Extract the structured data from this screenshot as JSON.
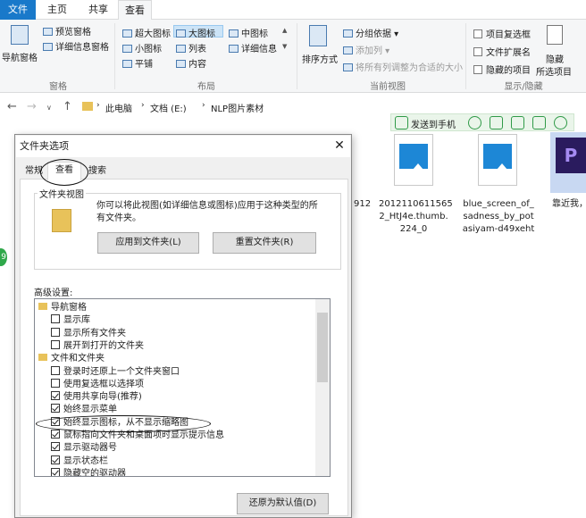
{
  "tabs": {
    "file": "文件",
    "home": "主页",
    "share": "共享",
    "view": "查看"
  },
  "ribbon": {
    "pane": {
      "nav_pane": "导航窗格",
      "preview": "预览窗格",
      "details": "详细信息窗格",
      "group": "窗格"
    },
    "layout": {
      "xl": "超大图标",
      "large": "大图标",
      "medium": "中图标",
      "small": "小图标",
      "list": "列表",
      "details": "详细信息",
      "tiles": "平铺",
      "content": "内容",
      "group": "布局"
    },
    "view": {
      "sort": "排序方式",
      "group_by": "分组依据",
      "add_column": "添加列",
      "fit_columns": "将所有列调整为合适的大小",
      "group": "当前视图"
    },
    "showhide": {
      "checkboxes": "项目复选框",
      "extensions": "文件扩展名",
      "hidden": "隐藏的项目",
      "hide": "隐藏",
      "selected": "所选项目",
      "group": "显示/隐藏"
    }
  },
  "address": {
    "crumbs": [
      "此电脑",
      "文档 (E:)",
      "NLP图片素材"
    ]
  },
  "float_toolbar": {
    "send": "发送到手机"
  },
  "files": [
    {
      "name": "2012110611565\n2_HtJ4e.thumb.\n224_0"
    },
    {
      "name": "blue_screen_of_\nsadness_by_pot\nasiyam-d49xeht"
    },
    {
      "name": "靠近我，"
    },
    {
      "name": "912"
    }
  ],
  "dialog": {
    "title": "文件夹选项",
    "tabs": [
      "常规",
      "查看",
      "搜索"
    ],
    "folder_view": {
      "legend": "文件夹视图",
      "desc": "你可以将此视图(如详细信息或图标)应用于这种类型的所\n有文件夹。",
      "apply": "应用到文件夹(L)",
      "reset": "重置文件夹(R)"
    },
    "advanced_label": "高级设置:",
    "tree": [
      {
        "t": "folder",
        "label": "导航窗格",
        "indent": 0
      },
      {
        "t": "cb",
        "label": "显示库",
        "on": false,
        "indent": 1
      },
      {
        "t": "cb",
        "label": "显示所有文件夹",
        "on": false,
        "indent": 1
      },
      {
        "t": "cb",
        "label": "展开到打开的文件夹",
        "on": false,
        "indent": 1
      },
      {
        "t": "folder",
        "label": "文件和文件夹",
        "indent": 0
      },
      {
        "t": "cb",
        "label": "登录时还原上一个文件夹窗口",
        "on": false,
        "indent": 1
      },
      {
        "t": "cb",
        "label": "使用复选框以选择项",
        "on": false,
        "indent": 1
      },
      {
        "t": "cb",
        "label": "使用共享向导(推荐)",
        "on": true,
        "indent": 1
      },
      {
        "t": "cb",
        "label": "始终显示菜单",
        "on": true,
        "indent": 1
      },
      {
        "t": "cb",
        "label": "始终显示图标，从不显示缩略图",
        "on": true,
        "indent": 1
      },
      {
        "t": "cb",
        "label": "鼠标指向文件夹和桌面项时显示提示信息",
        "on": true,
        "indent": 1
      },
      {
        "t": "cb",
        "label": "显示驱动器号",
        "on": true,
        "indent": 1
      },
      {
        "t": "cb",
        "label": "显示状态栏",
        "on": true,
        "indent": 1
      },
      {
        "t": "cb",
        "label": "隐藏空的驱动器",
        "on": true,
        "indent": 1
      }
    ],
    "restore": "还原为默认值(D)"
  },
  "bubble": "9",
  "colors": {
    "accent": "#1979ca",
    "selection": "#cce4f7"
  }
}
